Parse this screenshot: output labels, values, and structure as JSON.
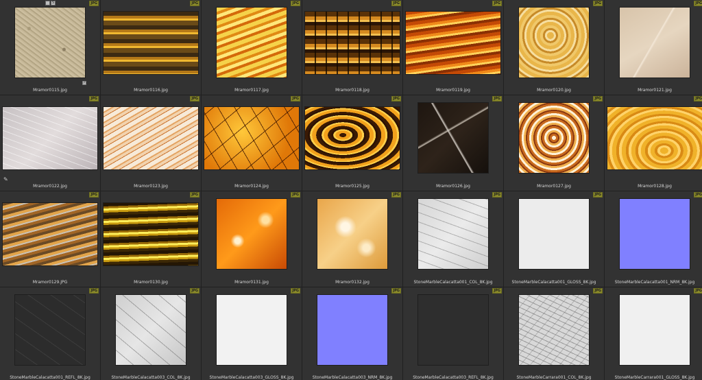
{
  "badge_label": "JPG",
  "toolbar": {
    "icon_a": "",
    "icon_b": "S"
  },
  "check_mark": "✓",
  "pencil_glyph": "✎",
  "files": [
    {
      "name": "Mramor0115.jpg",
      "shape": "square",
      "texture": "t0"
    },
    {
      "name": "Mramor0116.jpg",
      "shape": "wide",
      "texture": "t1"
    },
    {
      "name": "Mramor0117.jpg",
      "shape": "square",
      "texture": "t2"
    },
    {
      "name": "Mramor0118.jpg",
      "shape": "wide",
      "texture": "t3"
    },
    {
      "name": "Mramor0119.jpg",
      "shape": "wide",
      "texture": "t4"
    },
    {
      "name": "Mramor0120.jpg",
      "shape": "square",
      "texture": "t5"
    },
    {
      "name": "Mramor0121.jpg",
      "shape": "square",
      "texture": "t6"
    },
    {
      "name": "Mramor0122.jpg",
      "shape": "wide",
      "texture": "t7"
    },
    {
      "name": "Mramor0123.jpg",
      "shape": "wide",
      "texture": "t8"
    },
    {
      "name": "Mramor0124.jpg",
      "shape": "wide",
      "texture": "t9"
    },
    {
      "name": "Mramor0125.jpg",
      "shape": "wide",
      "texture": "t10"
    },
    {
      "name": "Mramor0126.jpg",
      "shape": "square",
      "texture": "t11"
    },
    {
      "name": "Mramor0127.jpg",
      "shape": "square",
      "texture": "t12"
    },
    {
      "name": "Mramor0128.jpg",
      "shape": "wide",
      "texture": "t13"
    },
    {
      "name": "Mramor0129.JPG",
      "shape": "wide",
      "texture": "t14"
    },
    {
      "name": "Mramor0130.jpg",
      "shape": "wide",
      "texture": "t15"
    },
    {
      "name": "Mramor0131.jpg",
      "shape": "square",
      "texture": "t16"
    },
    {
      "name": "Mramor0132.jpg",
      "shape": "square",
      "texture": "t17"
    },
    {
      "name": "StoneMarbleCalacatta001_COL_8K.jpg",
      "shape": "square",
      "texture": "t18"
    },
    {
      "name": "StoneMarbleCalacatta001_GLOSS_8K.jpg",
      "shape": "square",
      "texture": "t19"
    },
    {
      "name": "StoneMarbleCalacatta001_NRM_8K.jpg",
      "shape": "square",
      "texture": "t20"
    },
    {
      "name": "StoneMarbleCalacatta001_REFL_8K.jpg",
      "shape": "square",
      "texture": "t21"
    },
    {
      "name": "StoneMarbleCalacatta003_COL_8K.jpg",
      "shape": "square",
      "texture": "t22"
    },
    {
      "name": "StoneMarbleCalacatta003_GLOSS_8K.jpg",
      "shape": "square",
      "texture": "t23"
    },
    {
      "name": "StoneMarbleCalacatta003_NRM_8K.jpg",
      "shape": "square",
      "texture": "t24"
    },
    {
      "name": "StoneMarbleCalacatta003_REFL_8K.jpg",
      "shape": "square",
      "texture": "t25"
    },
    {
      "name": "StoneMarbleCarrara001_COL_8K.jpg",
      "shape": "square",
      "texture": "t26"
    },
    {
      "name": "StoneMarbleCarrara001_GLOSS_8K.jpg",
      "shape": "square",
      "texture": "t27"
    }
  ]
}
